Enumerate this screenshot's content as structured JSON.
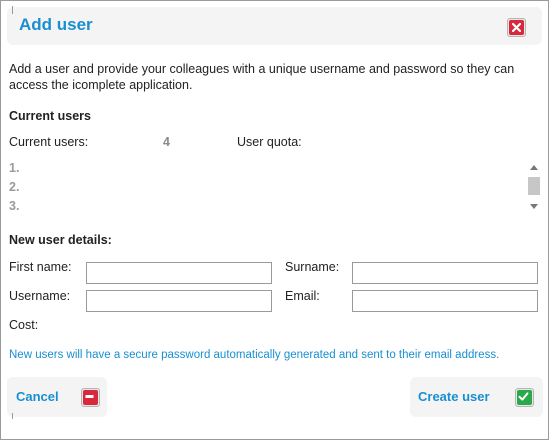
{
  "dialog": {
    "title": "Add user",
    "intro": "Add a user and provide your colleagues with a unique username and password so they can access the icomplete application."
  },
  "current_users": {
    "heading": "Current users",
    "count_label": "Current users:",
    "count_value": "4",
    "quota_label": "User quota:",
    "quota_value": "",
    "list": [
      "1.",
      "2.",
      "3."
    ]
  },
  "new_user": {
    "heading": "New user details:",
    "first_name_label": "First name:",
    "first_name_value": "",
    "surname_label": "Surname:",
    "surname_value": "",
    "username_label": "Username:",
    "username_value": "",
    "email_label": "Email:",
    "email_value": "",
    "cost_label": "Cost:",
    "cost_value": ""
  },
  "notice": "New users will have a secure password automatically generated and sent to their email address.",
  "buttons": {
    "cancel_label": "Cancel",
    "create_label": "Create user"
  },
  "colors": {
    "accent": "#1a8fd0",
    "close_red": "#d9283b",
    "cancel_red": "#d9283b",
    "create_green": "#2aa94a"
  },
  "icons": {
    "close": "close-x-icon",
    "cancel": "minus-icon",
    "create": "check-icon"
  }
}
